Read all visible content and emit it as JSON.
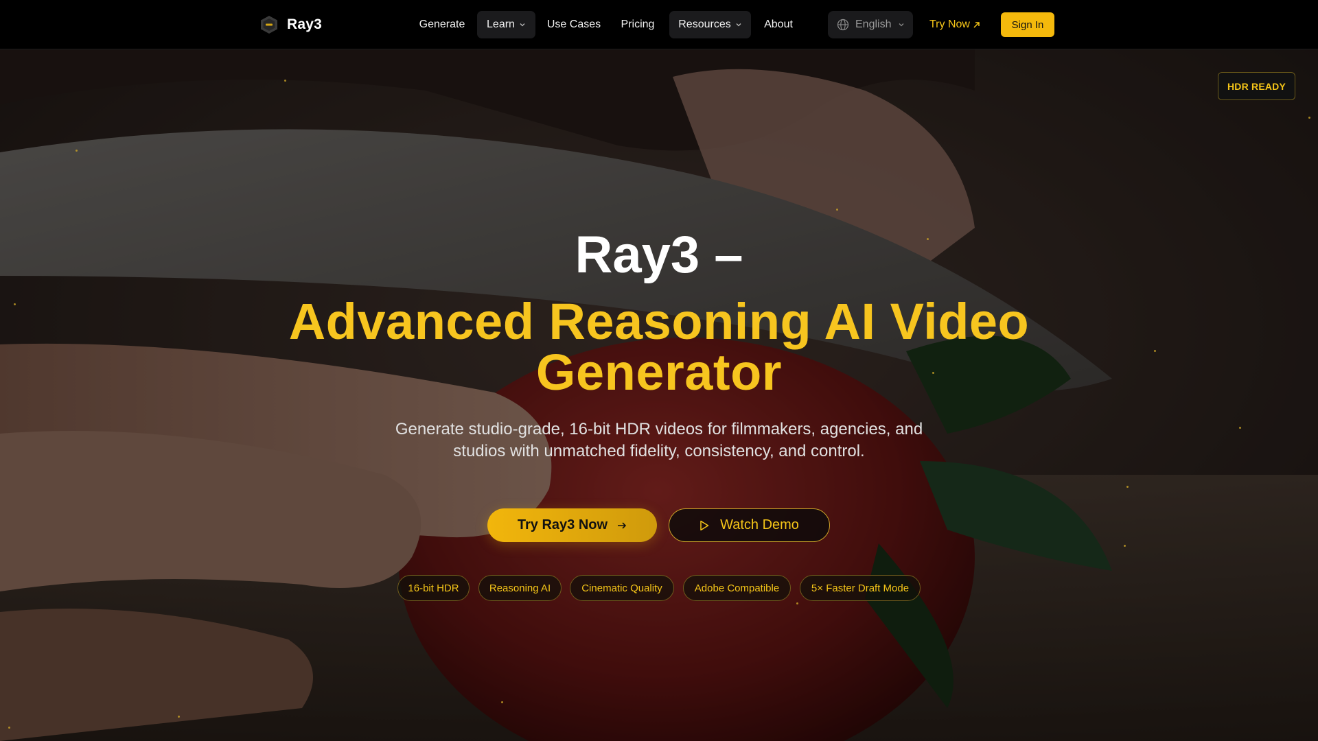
{
  "brand": {
    "name": "Ray3",
    "logo_icon": "hexagon-logo-icon"
  },
  "nav": {
    "items": [
      {
        "label": "Generate",
        "dropdown": false
      },
      {
        "label": "Learn",
        "dropdown": true
      },
      {
        "label": "Use Cases",
        "dropdown": false
      },
      {
        "label": "Pricing",
        "dropdown": false
      },
      {
        "label": "Resources",
        "dropdown": true
      },
      {
        "label": "About",
        "dropdown": false
      }
    ],
    "language": "English",
    "try_now": "Try Now",
    "sign_in": "Sign In"
  },
  "hero": {
    "badge": "HDR READY",
    "title_line1": "Ray3 –",
    "title_line2": "Advanced Reasoning AI Video Generator",
    "subtitle": "Generate studio-grade, 16-bit HDR videos for filmmakers, agencies, and studios with unmatched fidelity, consistency, and control.",
    "primary_cta": "Try Ray3 Now",
    "secondary_cta": "Watch Demo",
    "chips": [
      "16-bit HDR",
      "Reasoning AI",
      "Cinematic Quality",
      "Adobe Compatible",
      "5× Faster Draft Mode"
    ]
  },
  "colors": {
    "accent": "#f5c518",
    "accent_button": "#f5b90c",
    "background": "#000000",
    "title_yellow": "#f7c51f"
  }
}
